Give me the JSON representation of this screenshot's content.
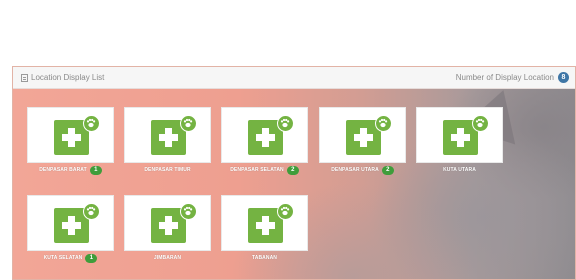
{
  "header": {
    "title": "Location Display List",
    "count_label": "Number of Display Location",
    "count": "8"
  },
  "colors": {
    "accent_green": "#74b342",
    "badge_green": "#3f9d3b",
    "badge_blue": "#3f76a6"
  },
  "locations": [
    {
      "name": "DENPASAR BARAT",
      "badge": "1",
      "icon": "pharmacy-paw-icon"
    },
    {
      "name": "DENPASAR TIMUR",
      "badge": null,
      "icon": "pharmacy-paw-icon"
    },
    {
      "name": "DENPASAR SELATAN",
      "badge": "2",
      "icon": "pharmacy-paw-icon"
    },
    {
      "name": "DENPASAR UTARA",
      "badge": "2",
      "icon": "pharmacy-paw-icon"
    },
    {
      "name": "KUTA UTARA",
      "badge": null,
      "icon": "pharmacy-paw-icon"
    },
    {
      "name": "KUTA SELATAN",
      "badge": "1",
      "icon": "pharmacy-paw-icon"
    },
    {
      "name": "JIMBARAN",
      "badge": null,
      "icon": "pharmacy-paw-icon"
    },
    {
      "name": "TABANAN",
      "badge": null,
      "icon": "pharmacy-paw-icon"
    }
  ]
}
